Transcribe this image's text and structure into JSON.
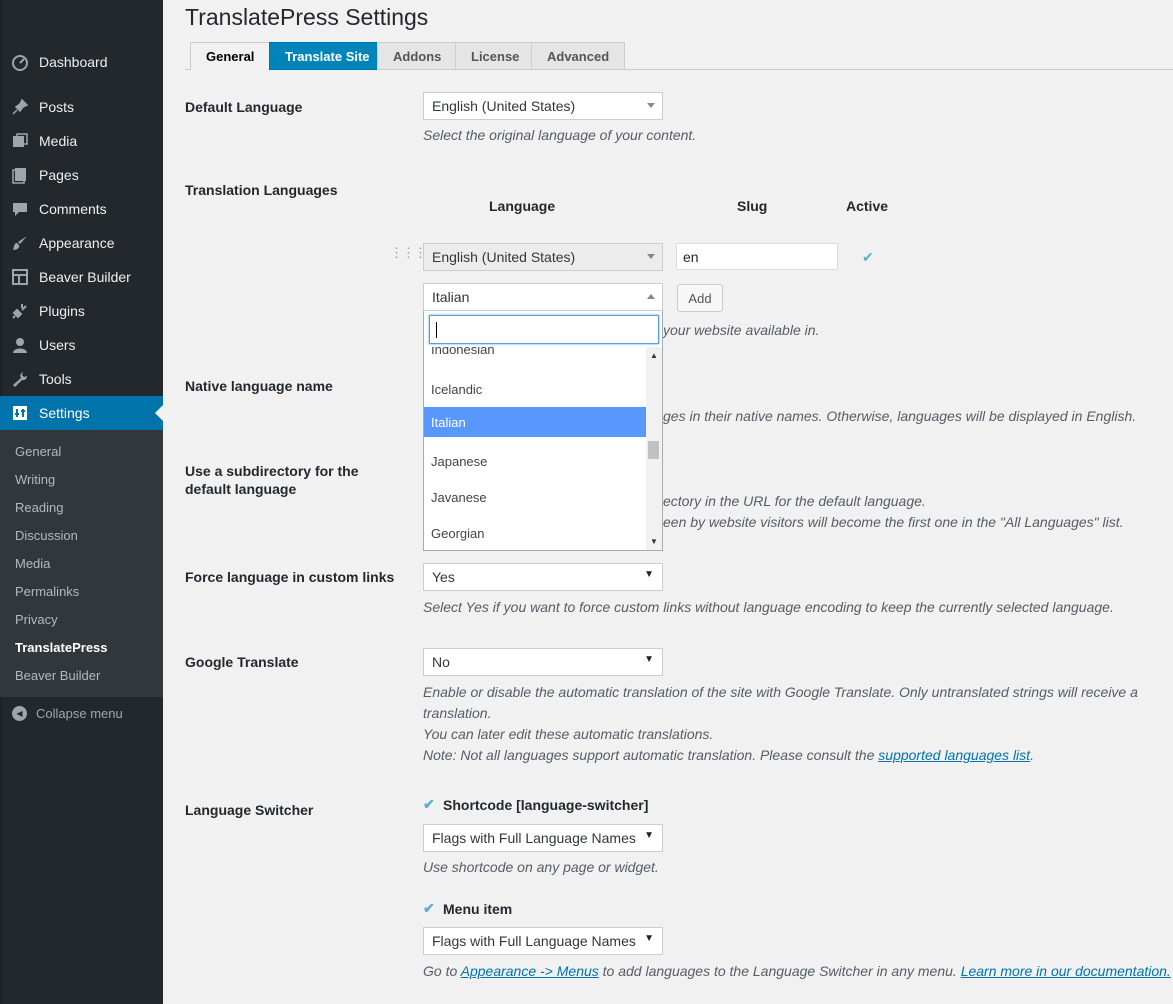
{
  "sidebar": {
    "items": [
      {
        "label": "Dashboard",
        "icon": "dashboard-icon"
      },
      {
        "label": "Posts",
        "icon": "pin-icon"
      },
      {
        "label": "Media",
        "icon": "media-icon"
      },
      {
        "label": "Pages",
        "icon": "pages-icon"
      },
      {
        "label": "Comments",
        "icon": "comment-icon"
      },
      {
        "label": "Appearance",
        "icon": "brush-icon"
      },
      {
        "label": "Beaver Builder",
        "icon": "layout-icon"
      },
      {
        "label": "Plugins",
        "icon": "plug-icon"
      },
      {
        "label": "Users",
        "icon": "user-icon"
      },
      {
        "label": "Tools",
        "icon": "wrench-icon"
      },
      {
        "label": "Settings",
        "icon": "settings-icon"
      }
    ],
    "submenu": [
      "General",
      "Writing",
      "Reading",
      "Discussion",
      "Media",
      "Permalinks",
      "Privacy",
      "TranslatePress",
      "Beaver Builder"
    ],
    "current_submenu": "TranslatePress",
    "collapse_label": "Collapse menu"
  },
  "page": {
    "title": "TranslatePress Settings"
  },
  "tabs": [
    {
      "label": "General",
      "state": "active"
    },
    {
      "label": "Translate Site",
      "state": "primary"
    },
    {
      "label": "Addons",
      "state": "normal"
    },
    {
      "label": "License",
      "state": "normal"
    },
    {
      "label": "Advanced",
      "state": "normal"
    }
  ],
  "settings": {
    "default_language": {
      "label": "Default Language",
      "value": "English (United States)",
      "description": "Select the original language of your content."
    },
    "translation_languages": {
      "label": "Translation Languages",
      "col_language": "Language",
      "col_slug": "Slug",
      "col_active": "Active",
      "row_language": "English (United States)",
      "row_slug": "en",
      "add_select_value": "Italian",
      "add_button": "Add",
      "description_partial": "your website available in."
    },
    "native_language_name": {
      "label": "Native language name",
      "description_partial": "ges in their native names. Otherwise, languages will be displayed in English."
    },
    "subdirectory": {
      "label_line1": "Use a subdirectory for the",
      "label_line2": "default language",
      "description_line1": "ectory in the URL for the default language.",
      "description_line2": "een by website visitors will become the first one in the \"All Languages\" list."
    },
    "force_language": {
      "label": "Force language in custom links",
      "value": "Yes",
      "description": "Select Yes if you want to force custom links without language encoding to keep the currently selected language."
    },
    "google_translate": {
      "label": "Google Translate",
      "value": "No",
      "description_line1": "Enable or disable the automatic translation of the site with Google Translate. Only untranslated strings will receive a",
      "description_line2": "translation.",
      "description_line3": "You can later edit these automatic translations.",
      "description_line4_prefix": "Note: Not all languages support automatic translation. Please consult the ",
      "description_link": "supported languages list",
      "description_line4_suffix": "."
    },
    "language_switcher": {
      "label": "Language Switcher",
      "shortcode_label": "Shortcode [language-switcher]",
      "shortcode_value": "Flags with Full Language Names",
      "shortcode_description": "Use shortcode on any page or widget.",
      "menu_item_label": "Menu item",
      "menu_item_value": "Flags with Full Language Names",
      "menu_desc_prefix": "Go to ",
      "menu_desc_link1": "Appearance -> Menus",
      "menu_desc_middle": " to add languages to the Language Switcher in any menu. ",
      "menu_desc_link2": "Learn more in our documentation."
    }
  },
  "dropdown": {
    "search_value": "",
    "options": [
      "Indonesian",
      "Icelandic",
      "Italian",
      "Japanese",
      "Javanese",
      "Georgian"
    ],
    "highlighted": "Italian"
  },
  "colors": {
    "sidebar_bg": "#23282d",
    "accent": "#0073aa",
    "highlight": "#5897fb",
    "check": "#5ab0d4"
  }
}
